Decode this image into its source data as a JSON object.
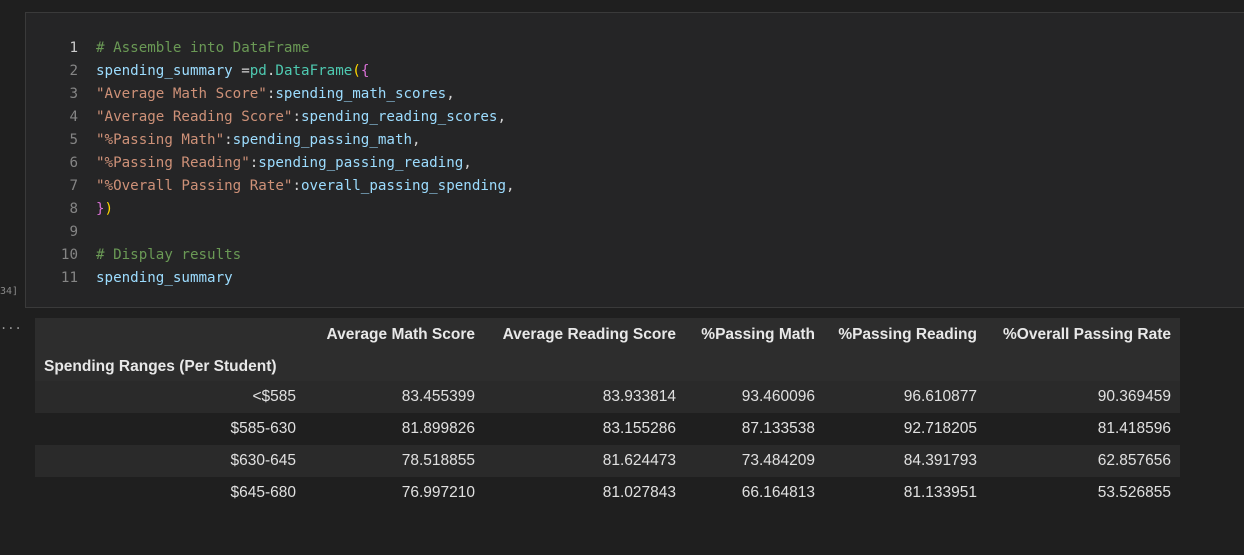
{
  "cell": {
    "execution_count": "34]",
    "output_marker": "..."
  },
  "code": {
    "lines": [
      {
        "num": "1",
        "tokens": [
          {
            "t": "# Assemble into DataFrame",
            "c": "comment"
          }
        ]
      },
      {
        "num": "2",
        "tokens": [
          {
            "t": "spending_summary",
            "c": "var"
          },
          {
            "t": " =",
            "c": "op"
          },
          {
            "t": "pd",
            "c": "ns"
          },
          {
            "t": ".",
            "c": "op"
          },
          {
            "t": "DataFrame",
            "c": "ns"
          },
          {
            "t": "(",
            "c": "paren"
          },
          {
            "t": "{",
            "c": "brace"
          }
        ]
      },
      {
        "num": "3",
        "tokens": [
          {
            "t": "\"Average Math Score\"",
            "c": "str"
          },
          {
            "t": ":",
            "c": "op"
          },
          {
            "t": "spending_math_scores",
            "c": "var"
          },
          {
            "t": ",",
            "c": "op"
          }
        ]
      },
      {
        "num": "4",
        "tokens": [
          {
            "t": "\"Average Reading Score\"",
            "c": "str"
          },
          {
            "t": ":",
            "c": "op"
          },
          {
            "t": "spending_reading_scores",
            "c": "var"
          },
          {
            "t": ",",
            "c": "op"
          }
        ]
      },
      {
        "num": "5",
        "tokens": [
          {
            "t": "\"%Passing Math\"",
            "c": "str"
          },
          {
            "t": ":",
            "c": "op"
          },
          {
            "t": "spending_passing_math",
            "c": "var"
          },
          {
            "t": ",",
            "c": "op"
          }
        ]
      },
      {
        "num": "6",
        "tokens": [
          {
            "t": "\"%Passing Reading\"",
            "c": "str"
          },
          {
            "t": ":",
            "c": "op"
          },
          {
            "t": "spending_passing_reading",
            "c": "var"
          },
          {
            "t": ",",
            "c": "op"
          }
        ]
      },
      {
        "num": "7",
        "tokens": [
          {
            "t": "\"%Overall Passing Rate\"",
            "c": "str"
          },
          {
            "t": ":",
            "c": "op"
          },
          {
            "t": "overall_passing_spending",
            "c": "var"
          },
          {
            "t": ",",
            "c": "op"
          }
        ]
      },
      {
        "num": "8",
        "tokens": [
          {
            "t": "}",
            "c": "brace"
          },
          {
            "t": ")",
            "c": "paren"
          }
        ]
      },
      {
        "num": "9",
        "tokens": []
      },
      {
        "num": "10",
        "tokens": [
          {
            "t": "# Display results",
            "c": "comment"
          }
        ]
      },
      {
        "num": "11",
        "tokens": [
          {
            "t": "spending_summary",
            "c": "var"
          }
        ]
      }
    ],
    "active_line": "1"
  },
  "table": {
    "index_name": "Spending Ranges (Per Student)",
    "columns": [
      "Average Math Score",
      "Average Reading Score",
      "%Passing Math",
      "%Passing Reading",
      "%Overall Passing Rate"
    ],
    "rows": [
      {
        "index": "<$585",
        "values": [
          "83.455399",
          "83.933814",
          "93.460096",
          "96.610877",
          "90.369459"
        ]
      },
      {
        "index": "$585-630",
        "values": [
          "81.899826",
          "83.155286",
          "87.133538",
          "92.718205",
          "81.418596"
        ]
      },
      {
        "index": "$630-645",
        "values": [
          "78.518855",
          "81.624473",
          "73.484209",
          "84.391793",
          "62.857656"
        ]
      },
      {
        "index": "$645-680",
        "values": [
          "76.997210",
          "81.027843",
          "66.164813",
          "81.133951",
          "53.526855"
        ]
      }
    ]
  }
}
